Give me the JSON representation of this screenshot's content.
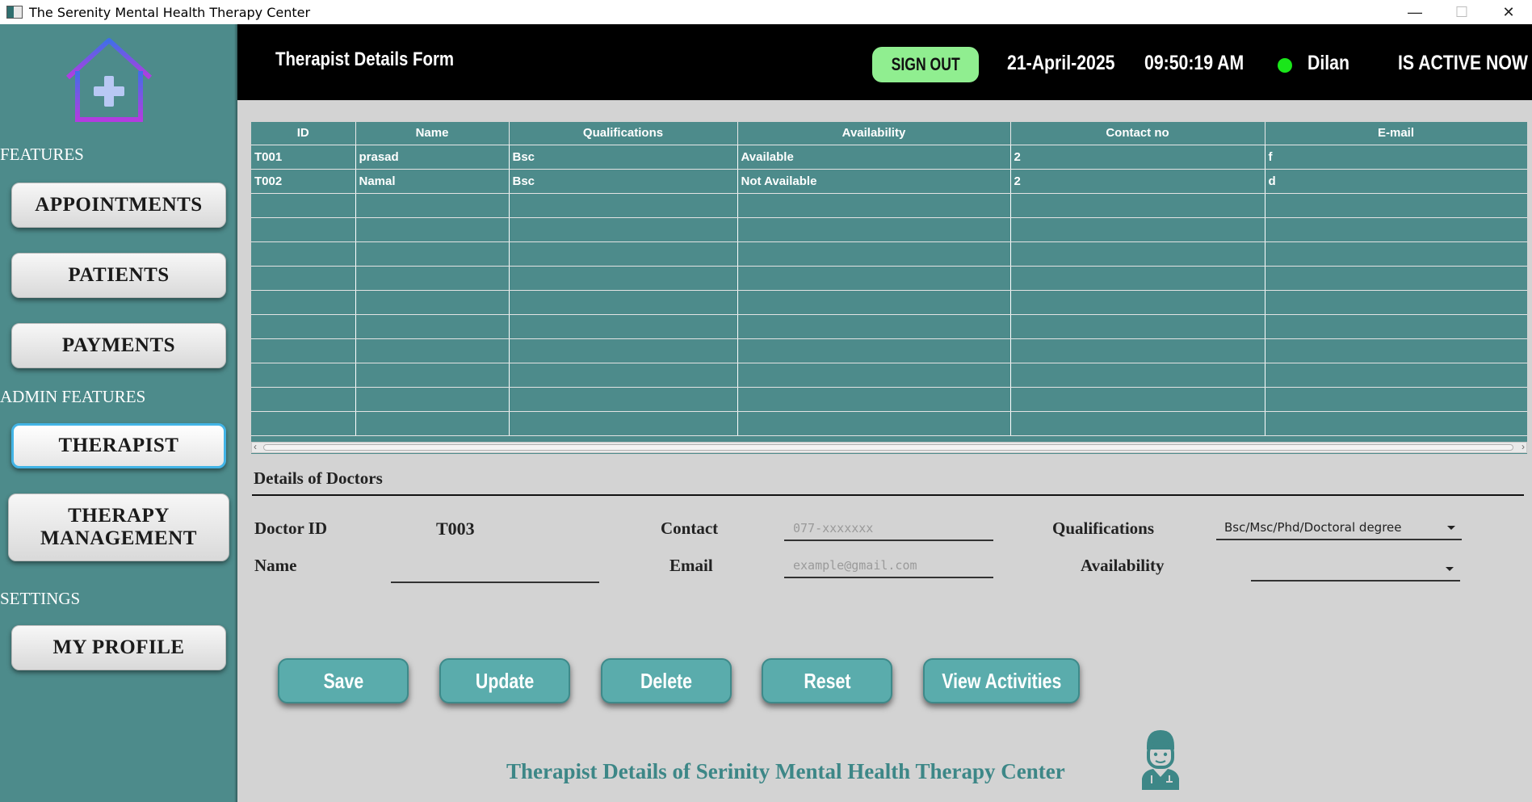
{
  "window": {
    "title": "The Serenity Mental Health Therapy Center",
    "controls": {
      "minimize": "—",
      "maximize": "☐",
      "close": "✕"
    }
  },
  "sidebar": {
    "logo_icon": "medical-home-icon",
    "sections": {
      "features": "FEATURES",
      "admin_features": "ADMIN FEATURES",
      "settings": "SETTINGS"
    },
    "buttons": {
      "appointments": "APPOINTMENTS",
      "patients": "PATIENTS",
      "payments": "PAYMENTS",
      "therapist": "THERAPIST",
      "therapy_management_line1": "THERAPY",
      "therapy_management_line2": "MANAGEMENT",
      "my_profile": "MY PROFILE"
    },
    "active": "THERAPIST"
  },
  "header": {
    "form_title": "Therapist Details Form",
    "sign_out": "SIGN OUT",
    "date": "21-April-2025",
    "time": "09:50:19  AM",
    "user": "Dilan",
    "status": "IS ACTIVE NOW",
    "status_color": "#1ae61a"
  },
  "table": {
    "columns": [
      "ID",
      "Name",
      "Qualifications",
      "Availability",
      "Contact no",
      "E-mail"
    ],
    "rows": [
      [
        "T001",
        "prasad",
        "Bsc",
        "Available",
        "2",
        "f"
      ],
      [
        "T002",
        "Namal",
        "Bsc",
        "Not Available",
        "2",
        "d"
      ]
    ],
    "empty_rows": 10
  },
  "details": {
    "title": "Details of Doctors",
    "doctor_id_label": "Doctor ID",
    "doctor_id_value": "T003",
    "name_label": "Name",
    "name_value": "",
    "contact_label": "Contact",
    "contact_placeholder": "077-xxxxxxx",
    "email_label": "Email",
    "email_placeholder": "example@gmail.com",
    "qualifications_label": "Qualifications",
    "qualifications_value": "Bsc/Msc/Phd/Doctoral degree",
    "availability_label": "Availability",
    "availability_value": ""
  },
  "actions": {
    "save": "Save",
    "update": "Update",
    "delete": "Delete",
    "reset": "Reset",
    "view_activities": "View Activities"
  },
  "footer": {
    "text": "Therapist Details of Serinity Mental Health Therapy Center",
    "icon": "doctor-icon"
  },
  "colors": {
    "sidebar": "#4d8b8b",
    "header": "#000000",
    "accent_button": "#5aacac",
    "sign_out": "#90ee90"
  }
}
